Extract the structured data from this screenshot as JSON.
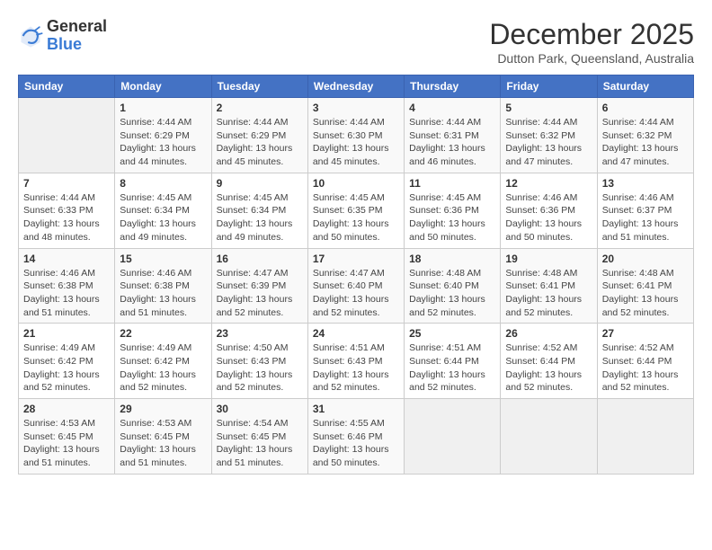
{
  "header": {
    "logo": {
      "general": "General",
      "blue": "Blue"
    },
    "title": "December 2025",
    "subtitle": "Dutton Park, Queensland, Australia"
  },
  "calendar": {
    "days_of_week": [
      "Sunday",
      "Monday",
      "Tuesday",
      "Wednesday",
      "Thursday",
      "Friday",
      "Saturday"
    ],
    "weeks": [
      [
        {
          "day": "",
          "info": ""
        },
        {
          "day": "1",
          "info": "Sunrise: 4:44 AM\nSunset: 6:29 PM\nDaylight: 13 hours\nand 44 minutes."
        },
        {
          "day": "2",
          "info": "Sunrise: 4:44 AM\nSunset: 6:29 PM\nDaylight: 13 hours\nand 45 minutes."
        },
        {
          "day": "3",
          "info": "Sunrise: 4:44 AM\nSunset: 6:30 PM\nDaylight: 13 hours\nand 45 minutes."
        },
        {
          "day": "4",
          "info": "Sunrise: 4:44 AM\nSunset: 6:31 PM\nDaylight: 13 hours\nand 46 minutes."
        },
        {
          "day": "5",
          "info": "Sunrise: 4:44 AM\nSunset: 6:32 PM\nDaylight: 13 hours\nand 47 minutes."
        },
        {
          "day": "6",
          "info": "Sunrise: 4:44 AM\nSunset: 6:32 PM\nDaylight: 13 hours\nand 47 minutes."
        }
      ],
      [
        {
          "day": "7",
          "info": "Sunrise: 4:44 AM\nSunset: 6:33 PM\nDaylight: 13 hours\nand 48 minutes."
        },
        {
          "day": "8",
          "info": "Sunrise: 4:45 AM\nSunset: 6:34 PM\nDaylight: 13 hours\nand 49 minutes."
        },
        {
          "day": "9",
          "info": "Sunrise: 4:45 AM\nSunset: 6:34 PM\nDaylight: 13 hours\nand 49 minutes."
        },
        {
          "day": "10",
          "info": "Sunrise: 4:45 AM\nSunset: 6:35 PM\nDaylight: 13 hours\nand 50 minutes."
        },
        {
          "day": "11",
          "info": "Sunrise: 4:45 AM\nSunset: 6:36 PM\nDaylight: 13 hours\nand 50 minutes."
        },
        {
          "day": "12",
          "info": "Sunrise: 4:46 AM\nSunset: 6:36 PM\nDaylight: 13 hours\nand 50 minutes."
        },
        {
          "day": "13",
          "info": "Sunrise: 4:46 AM\nSunset: 6:37 PM\nDaylight: 13 hours\nand 51 minutes."
        }
      ],
      [
        {
          "day": "14",
          "info": "Sunrise: 4:46 AM\nSunset: 6:38 PM\nDaylight: 13 hours\nand 51 minutes."
        },
        {
          "day": "15",
          "info": "Sunrise: 4:46 AM\nSunset: 6:38 PM\nDaylight: 13 hours\nand 51 minutes."
        },
        {
          "day": "16",
          "info": "Sunrise: 4:47 AM\nSunset: 6:39 PM\nDaylight: 13 hours\nand 52 minutes."
        },
        {
          "day": "17",
          "info": "Sunrise: 4:47 AM\nSunset: 6:40 PM\nDaylight: 13 hours\nand 52 minutes."
        },
        {
          "day": "18",
          "info": "Sunrise: 4:48 AM\nSunset: 6:40 PM\nDaylight: 13 hours\nand 52 minutes."
        },
        {
          "day": "19",
          "info": "Sunrise: 4:48 AM\nSunset: 6:41 PM\nDaylight: 13 hours\nand 52 minutes."
        },
        {
          "day": "20",
          "info": "Sunrise: 4:48 AM\nSunset: 6:41 PM\nDaylight: 13 hours\nand 52 minutes."
        }
      ],
      [
        {
          "day": "21",
          "info": "Sunrise: 4:49 AM\nSunset: 6:42 PM\nDaylight: 13 hours\nand 52 minutes."
        },
        {
          "day": "22",
          "info": "Sunrise: 4:49 AM\nSunset: 6:42 PM\nDaylight: 13 hours\nand 52 minutes."
        },
        {
          "day": "23",
          "info": "Sunrise: 4:50 AM\nSunset: 6:43 PM\nDaylight: 13 hours\nand 52 minutes."
        },
        {
          "day": "24",
          "info": "Sunrise: 4:51 AM\nSunset: 6:43 PM\nDaylight: 13 hours\nand 52 minutes."
        },
        {
          "day": "25",
          "info": "Sunrise: 4:51 AM\nSunset: 6:44 PM\nDaylight: 13 hours\nand 52 minutes."
        },
        {
          "day": "26",
          "info": "Sunrise: 4:52 AM\nSunset: 6:44 PM\nDaylight: 13 hours\nand 52 minutes."
        },
        {
          "day": "27",
          "info": "Sunrise: 4:52 AM\nSunset: 6:44 PM\nDaylight: 13 hours\nand 52 minutes."
        }
      ],
      [
        {
          "day": "28",
          "info": "Sunrise: 4:53 AM\nSunset: 6:45 PM\nDaylight: 13 hours\nand 51 minutes."
        },
        {
          "day": "29",
          "info": "Sunrise: 4:53 AM\nSunset: 6:45 PM\nDaylight: 13 hours\nand 51 minutes."
        },
        {
          "day": "30",
          "info": "Sunrise: 4:54 AM\nSunset: 6:45 PM\nDaylight: 13 hours\nand 51 minutes."
        },
        {
          "day": "31",
          "info": "Sunrise: 4:55 AM\nSunset: 6:46 PM\nDaylight: 13 hours\nand 50 minutes."
        },
        {
          "day": "",
          "info": ""
        },
        {
          "day": "",
          "info": ""
        },
        {
          "day": "",
          "info": ""
        }
      ]
    ]
  }
}
